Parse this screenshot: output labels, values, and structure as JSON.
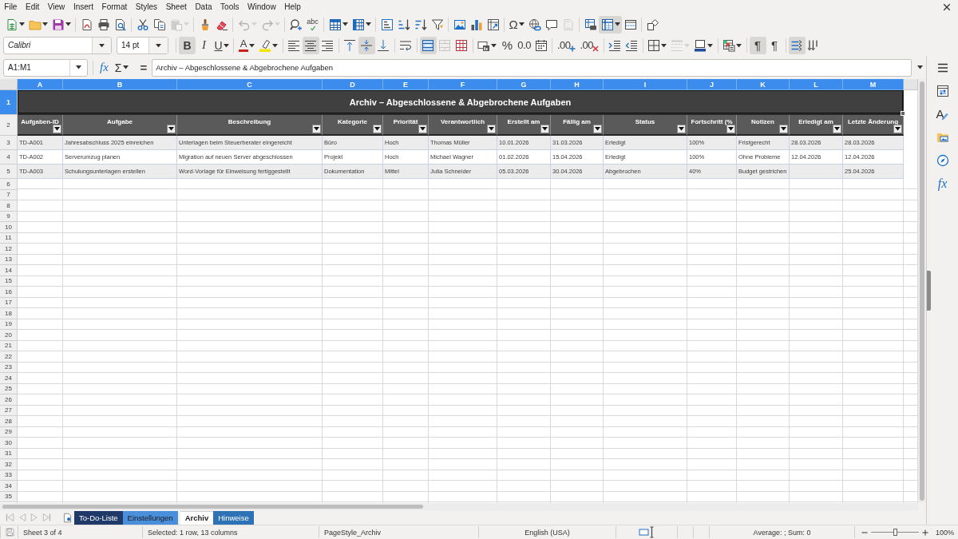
{
  "menu_bar": {
    "items": [
      "File",
      "Edit",
      "View",
      "Insert",
      "Format",
      "Styles",
      "Sheet",
      "Data",
      "Tools",
      "Window",
      "Help"
    ]
  },
  "standard_toolbar": {
    "groups": [
      [
        {
          "kind": "new",
          "dropdown": true,
          "pressed": false,
          "disabled": false
        },
        {
          "kind": "open",
          "dropdown": true,
          "pressed": false,
          "disabled": false
        },
        {
          "kind": "save",
          "dropdown": true,
          "pressed": false,
          "disabled": false
        }
      ],
      [
        {
          "kind": "export_pdf",
          "dropdown": false,
          "pressed": false,
          "disabled": false
        },
        {
          "kind": "print",
          "dropdown": false,
          "pressed": false,
          "disabled": false
        },
        {
          "kind": "print_preview",
          "dropdown": false,
          "pressed": false,
          "disabled": false
        }
      ],
      [
        {
          "kind": "cut",
          "dropdown": false,
          "pressed": false,
          "disabled": false
        },
        {
          "kind": "copy",
          "dropdown": false,
          "pressed": false,
          "disabled": false
        },
        {
          "kind": "paste",
          "dropdown": true,
          "pressed": false,
          "disabled": true
        }
      ],
      [
        {
          "kind": "clone_formatting",
          "dropdown": false,
          "pressed": false,
          "disabled": false
        },
        {
          "kind": "clear_formatting",
          "dropdown": false,
          "pressed": false,
          "disabled": false
        }
      ],
      [
        {
          "kind": "undo",
          "dropdown": true,
          "pressed": false,
          "disabled": true
        },
        {
          "kind": "redo",
          "dropdown": true,
          "pressed": false,
          "disabled": true
        }
      ],
      [
        {
          "kind": "find_replace",
          "dropdown": false,
          "pressed": false,
          "disabled": false
        },
        {
          "kind": "spelling",
          "glyph": "abc",
          "dropdown": false,
          "pressed": false,
          "disabled": false
        }
      ],
      [
        {
          "kind": "insert_rows",
          "dropdown": true,
          "pressed": false,
          "disabled": false
        },
        {
          "kind": "insert_columns",
          "dropdown": true,
          "pressed": false,
          "disabled": false
        }
      ],
      [
        {
          "kind": "sort",
          "dropdown": false,
          "pressed": false,
          "disabled": false
        },
        {
          "kind": "sort_ascending",
          "dropdown": false,
          "pressed": false,
          "disabled": false
        },
        {
          "kind": "sort_descending",
          "dropdown": false,
          "pressed": false,
          "disabled": false
        },
        {
          "kind": "autofilter",
          "dropdown": false,
          "pressed": false,
          "disabled": false
        }
      ],
      [
        {
          "kind": "insert_image",
          "dropdown": false,
          "pressed": false,
          "disabled": false
        },
        {
          "kind": "insert_chart",
          "dropdown": false,
          "pressed": false,
          "disabled": false
        },
        {
          "kind": "pivot_table",
          "dropdown": false,
          "pressed": false,
          "disabled": false
        }
      ],
      [
        {
          "kind": "special_character",
          "glyph": "Ω",
          "dropdown": true,
          "pressed": false,
          "disabled": false
        },
        {
          "kind": "hyperlink",
          "dropdown": false,
          "pressed": false,
          "disabled": false
        },
        {
          "kind": "comment",
          "dropdown": false,
          "pressed": false,
          "disabled": false
        },
        {
          "kind": "headers_footers",
          "dropdown": false,
          "pressed": false,
          "disabled": true
        }
      ],
      [
        {
          "kind": "print_area",
          "dropdown": false,
          "pressed": false,
          "disabled": false
        },
        {
          "kind": "freeze_panes",
          "dropdown": true,
          "pressed": true,
          "disabled": false
        },
        {
          "kind": "split_window",
          "dropdown": false,
          "pressed": false,
          "disabled": false
        }
      ],
      [
        {
          "kind": "draw_functions",
          "dropdown": false,
          "pressed": false,
          "disabled": false
        }
      ]
    ]
  },
  "formatting_toolbar": {
    "font_name": "Calibri",
    "font_size": "14 pt",
    "groups": [
      [
        {
          "kind": "bold",
          "glyph": "B",
          "dropdown": false,
          "pressed": true,
          "disabled": false
        },
        {
          "kind": "italic",
          "glyph": "I",
          "dropdown": false,
          "pressed": false,
          "disabled": false
        },
        {
          "kind": "underline",
          "glyph": "U",
          "dropdown": true,
          "pressed": false,
          "disabled": false
        }
      ],
      [
        {
          "kind": "font_color",
          "glyph": "A",
          "dropdown": true,
          "pressed": false,
          "disabled": false
        },
        {
          "kind": "highlight",
          "dropdown": true,
          "pressed": false,
          "disabled": false
        }
      ],
      [
        {
          "kind": "align_left",
          "dropdown": false,
          "pressed": false,
          "disabled": false
        },
        {
          "kind": "align_center",
          "dropdown": false,
          "pressed": true,
          "disabled": false
        },
        {
          "kind": "align_right",
          "dropdown": false,
          "pressed": false,
          "disabled": false
        }
      ],
      [
        {
          "kind": "align_top",
          "dropdown": false,
          "pressed": false,
          "disabled": false
        },
        {
          "kind": "center_vertically",
          "dropdown": false,
          "pressed": true,
          "disabled": false
        },
        {
          "kind": "align_bottom",
          "dropdown": false,
          "pressed": false,
          "disabled": false
        }
      ],
      [
        {
          "kind": "wrap_text",
          "dropdown": false,
          "pressed": false,
          "disabled": false
        }
      ],
      [
        {
          "kind": "merge_center",
          "dropdown": false,
          "pressed": true,
          "disabled": false
        },
        {
          "kind": "merge_cells",
          "dropdown": false,
          "pressed": false,
          "disabled": true
        },
        {
          "kind": "unmerge_cells",
          "dropdown": false,
          "pressed": false,
          "disabled": false
        }
      ],
      [
        {
          "kind": "currency_format",
          "dropdown": true,
          "pressed": false,
          "disabled": false
        },
        {
          "kind": "percent_format",
          "glyph": "%",
          "dropdown": false,
          "pressed": false,
          "disabled": false
        },
        {
          "kind": "number_format",
          "glyph": "0.0",
          "dropdown": false,
          "pressed": false,
          "disabled": false
        },
        {
          "kind": "date_format",
          "dropdown": false,
          "pressed": false,
          "disabled": false
        }
      ],
      [
        {
          "kind": "add_decimal",
          "glyph": ".00",
          "dropdown": false,
          "pressed": false,
          "disabled": false
        },
        {
          "kind": "delete_decimal",
          "glyph": ".00",
          "dropdown": false,
          "pressed": false,
          "disabled": false
        }
      ],
      [
        {
          "kind": "increase_indent",
          "dropdown": false,
          "pressed": false,
          "disabled": false
        },
        {
          "kind": "decrease_indent",
          "dropdown": false,
          "pressed": false,
          "disabled": false
        }
      ],
      [
        {
          "kind": "borders",
          "dropdown": true,
          "pressed": false,
          "disabled": false
        },
        {
          "kind": "border_style",
          "dropdown": true,
          "pressed": false,
          "disabled": true
        },
        {
          "kind": "border_color",
          "dropdown": true,
          "pressed": false,
          "disabled": false
        }
      ],
      [
        {
          "kind": "conditional_format",
          "dropdown": true,
          "pressed": false,
          "disabled": false
        }
      ],
      [
        {
          "kind": "left_to_right",
          "glyph": "¶",
          "dropdown": false,
          "pressed": true,
          "disabled": false
        },
        {
          "kind": "right_to_left",
          "glyph": "¶",
          "dropdown": false,
          "pressed": false,
          "disabled": false
        }
      ],
      [
        {
          "kind": "text_left_to_right",
          "dropdown": false,
          "pressed": true,
          "disabled": false
        },
        {
          "kind": "text_top_to_bottom",
          "dropdown": false,
          "pressed": false,
          "disabled": false
        }
      ]
    ]
  },
  "formula_bar": {
    "name_box": "A1:M1",
    "function_wizard": "fx",
    "sum": "Σ",
    "equals": "=",
    "content": "Archiv – Abgeschlossene & Abgebrochene Aufgaben"
  },
  "sidebar": {
    "items": [
      {
        "kind": "properties"
      },
      {
        "kind": "styles",
        "glyph": "A"
      },
      {
        "kind": "gallery"
      },
      {
        "kind": "navigator"
      },
      {
        "kind": "functions",
        "glyph": "fx"
      }
    ]
  },
  "sheet": {
    "columns": [
      {
        "label": "A",
        "selected": true
      },
      {
        "label": "B",
        "selected": true
      },
      {
        "label": "C",
        "selected": true
      },
      {
        "label": "D",
        "selected": true
      },
      {
        "label": "E",
        "selected": true
      },
      {
        "label": "F",
        "selected": true
      },
      {
        "label": "G",
        "selected": true
      },
      {
        "label": "H",
        "selected": true
      },
      {
        "label": "I",
        "selected": true
      },
      {
        "label": "J",
        "selected": true
      },
      {
        "label": "K",
        "selected": true
      },
      {
        "label": "L",
        "selected": true
      },
      {
        "label": "M",
        "selected": true
      }
    ],
    "row_headers": [
      {
        "label": "1",
        "selected": true
      },
      {
        "label": "2",
        "selected": false
      },
      {
        "label": "3",
        "selected": false
      },
      {
        "label": "4",
        "selected": false
      },
      {
        "label": "5",
        "selected": false
      },
      {
        "label": "6",
        "selected": false
      },
      {
        "label": "7",
        "selected": false
      },
      {
        "label": "8",
        "selected": false
      },
      {
        "label": "9",
        "selected": false
      },
      {
        "label": "10",
        "selected": false
      },
      {
        "label": "11",
        "selected": false
      },
      {
        "label": "12",
        "selected": false
      },
      {
        "label": "13",
        "selected": false
      },
      {
        "label": "14",
        "selected": false
      },
      {
        "label": "15",
        "selected": false
      },
      {
        "label": "16",
        "selected": false
      },
      {
        "label": "17",
        "selected": false
      },
      {
        "label": "18",
        "selected": false
      },
      {
        "label": "19",
        "selected": false
      },
      {
        "label": "20",
        "selected": false
      },
      {
        "label": "21",
        "selected": false
      },
      {
        "label": "22",
        "selected": false
      },
      {
        "label": "23",
        "selected": false
      },
      {
        "label": "24",
        "selected": false
      },
      {
        "label": "25",
        "selected": false
      },
      {
        "label": "26",
        "selected": false
      },
      {
        "label": "27",
        "selected": false
      },
      {
        "label": "28",
        "selected": false
      },
      {
        "label": "29",
        "selected": false
      },
      {
        "label": "30",
        "selected": false
      },
      {
        "label": "31",
        "selected": false
      },
      {
        "label": "32",
        "selected": false
      },
      {
        "label": "33",
        "selected": false
      },
      {
        "label": "34",
        "selected": false
      },
      {
        "label": "35",
        "selected": false
      }
    ],
    "title": {
      "text": "Archiv – Abgeschlossene & Abgebrochene Aufgaben",
      "selected": true
    },
    "header_row": [
      {
        "label": "Aufgaben-ID",
        "filter": true
      },
      {
        "label": "Aufgabe",
        "filter": true
      },
      {
        "label": "Beschreibung",
        "filter": true
      },
      {
        "label": "Kategorie",
        "filter": true
      },
      {
        "label": "Priorität",
        "filter": true
      },
      {
        "label": "Verantwortlich",
        "filter": true
      },
      {
        "label": "Erstellt am",
        "filter": true
      },
      {
        "label": "Fällig am",
        "filter": true
      },
      {
        "label": "Status",
        "filter": true
      },
      {
        "label": "Fortschritt (%",
        "filter": true
      },
      {
        "label": "Notizen",
        "filter": true
      },
      {
        "label": "Erledigt am",
        "filter": true
      },
      {
        "label": "Letzte Änderung",
        "filter": true
      }
    ],
    "rows": [
      {
        "shaded": true,
        "cells": [
          "TD-A001",
          "Jahresabschluss 2025 einreichen",
          "Unterlagen beim Steuerberater eingereicht",
          "Büro",
          "Hoch",
          "Thomas Müller",
          "10.01.2026",
          "31.03.2026",
          "Erledigt",
          "100%",
          "Fristgerecht",
          "28.03.2026",
          "28.03.2026"
        ]
      },
      {
        "shaded": false,
        "cells": [
          "TD-A002",
          "Serverumzug planen",
          "Migration auf neuen Server abgeschlossen",
          "Projekt",
          "Hoch",
          "Michael Wagner",
          "01.02.2026",
          "15.04.2026",
          "Erledigt",
          "100%",
          "Ohne Probleme",
          "12.04.2026",
          "12.04.2026"
        ]
      },
      {
        "shaded": true,
        "cells": [
          "TD-A003",
          "Schulungsunterlagen erstellen",
          "Word-Vorlage für Einweisung fertiggestellt",
          "Dokumentation",
          "Mittel",
          "Julia Schneider",
          "05.03.2026",
          "30.04.2026",
          "Abgebrochen",
          "40%",
          "Budget gestrichen",
          null,
          "25.04.2026"
        ]
      }
    ]
  },
  "sheet_tabs": {
    "navigation_disabled": true,
    "tabs": [
      {
        "label": "To-Do-Liste",
        "color": "#1f3a68",
        "selected": false
      },
      {
        "label": "Einstellungen",
        "color": "#4a8fdc",
        "selected": false
      },
      {
        "label": "Archiv",
        "selected": true
      },
      {
        "label": "Hinweise",
        "color": "#2e72b6",
        "selected": false
      }
    ]
  },
  "status_bar": {
    "sheet": "Sheet 3 of 4",
    "selection": "Selected: 1 row, 13 columns",
    "page_style": "PageStyle_Archiv",
    "language": "English (USA)",
    "summary": "Average: ; Sum: 0",
    "zoom": {
      "level": 0.5,
      "reading": "100%"
    }
  }
}
